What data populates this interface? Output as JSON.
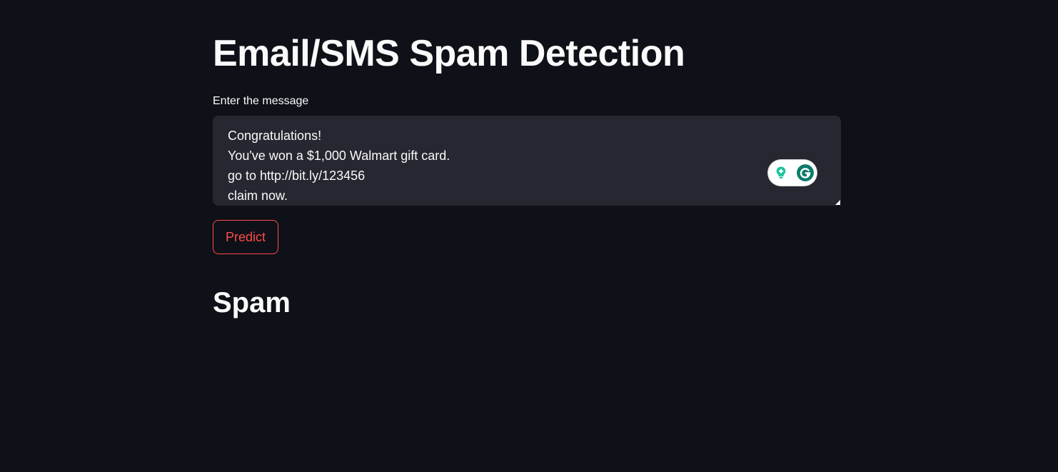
{
  "page": {
    "title": "Email/SMS Spam Detection",
    "background_color": "#0e1117",
    "accent_color": "#ff4b4b"
  },
  "input": {
    "label": "Enter the message",
    "value": "Congratulations!\nYou've won a $1,000 Walmart gift card.\ngo to http://bit.ly/123456\nclaim now."
  },
  "grammarly_widget": {
    "icons": [
      "lightbulb-icon",
      "grammarly-g-icon"
    ],
    "color": "#15c39a"
  },
  "actions": {
    "predict_label": "Predict"
  },
  "result": {
    "prediction": "Spam"
  }
}
